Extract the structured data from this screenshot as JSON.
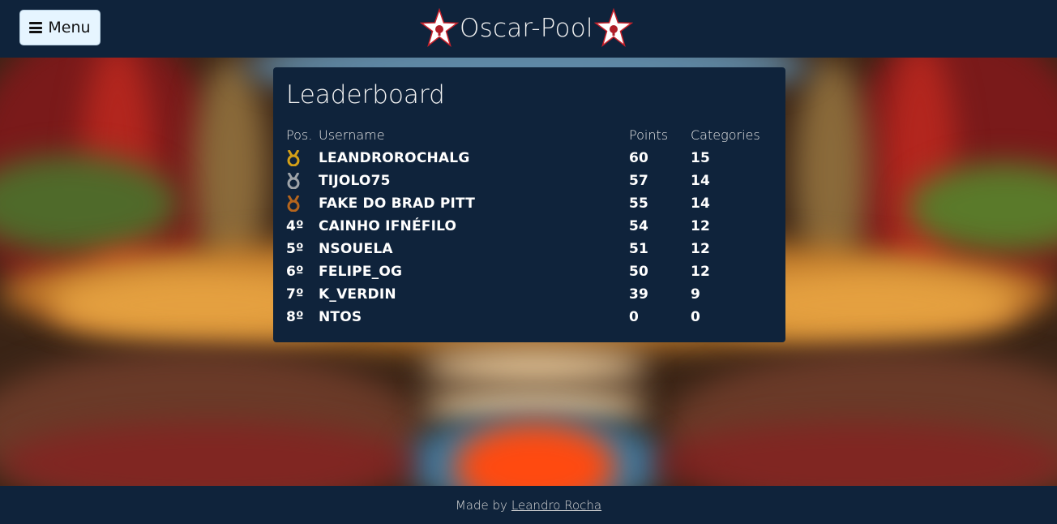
{
  "header": {
    "menu_label": "Menu",
    "brand": "Oscar-Pool"
  },
  "leaderboard": {
    "title": "Leaderboard",
    "columns": {
      "pos": "Pos.",
      "username": "Username",
      "points": "Points",
      "categories": "Categories"
    },
    "rows": [
      {
        "pos": "",
        "medal": "gold",
        "username": "LEANDROROCHALG",
        "points": "60",
        "categories": "15"
      },
      {
        "pos": "",
        "medal": "silver",
        "username": "TIJOLO75",
        "points": "57",
        "categories": "14"
      },
      {
        "pos": "",
        "medal": "bronze",
        "username": "FAKE DO BRAD PITT",
        "points": "55",
        "categories": "14"
      },
      {
        "pos": "4º",
        "username": "CAINHO IFNÉFILO",
        "points": "54",
        "categories": "12"
      },
      {
        "pos": "5º",
        "username": "NSOUELA",
        "points": "51",
        "categories": "12"
      },
      {
        "pos": "6º",
        "username": "FELIPE_OG",
        "points": "50",
        "categories": "12"
      },
      {
        "pos": "7º",
        "username": "K_VERDIN",
        "points": "39",
        "categories": "9"
      },
      {
        "pos": "8º",
        "username": "NTOS",
        "points": "0",
        "categories": "0"
      }
    ]
  },
  "footer": {
    "prefix": "Made by",
    "author_link": "Leandro Rocha"
  },
  "colors": {
    "navy": "#0f233b",
    "gold": "#d4a017",
    "silver": "#9ea3a8",
    "bronze": "#b5651d"
  }
}
